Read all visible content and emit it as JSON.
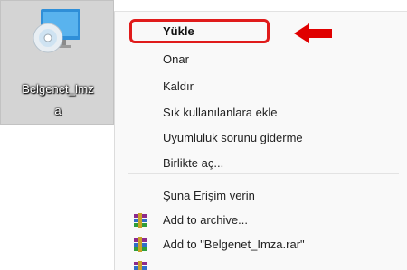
{
  "desktop": {
    "icon_label_line1": "Belgenet_Imz",
    "icon_label_line2": "a"
  },
  "context_menu": {
    "items": [
      {
        "label": "Yükle",
        "bold": true
      },
      {
        "label": "Onar"
      },
      {
        "label": "Kaldır"
      },
      {
        "label": "Sık kullanılanlara ekle"
      },
      {
        "label": "Uyumluluk sorunu giderme"
      },
      {
        "label": "Birlikte aç..."
      },
      {
        "label": "Şuna Erişim verin"
      },
      {
        "label": "Add to archive...",
        "icon": "winrar-archive-icon"
      },
      {
        "label": "Add to \"Belgenet_Imza.rar\"",
        "icon": "winrar-archive-icon"
      }
    ],
    "highlight_color": "#e01b1b",
    "arrow_color": "#e00000"
  }
}
